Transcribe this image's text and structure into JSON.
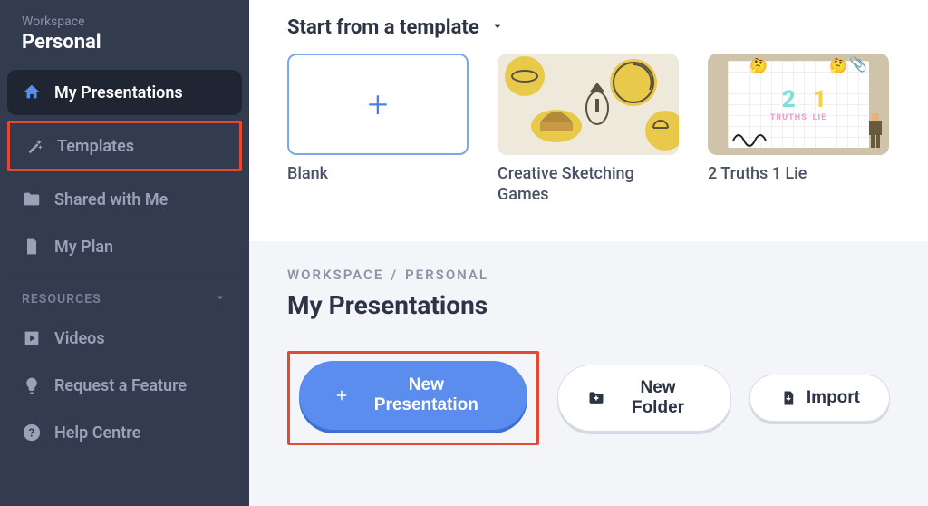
{
  "sidebar": {
    "workspace_label": "Workspace",
    "workspace_name": "Personal",
    "nav": {
      "my_presentations": "My Presentations",
      "templates": "Templates",
      "shared": "Shared with Me",
      "my_plan": "My Plan"
    },
    "resources_heading": "RESOURCES",
    "resources": {
      "videos": "Videos",
      "request_feature": "Request a Feature",
      "help_centre": "Help Centre"
    }
  },
  "templates": {
    "heading": "Start from a template",
    "items": [
      {
        "label": "Blank"
      },
      {
        "label": "Creative Sketching Games"
      },
      {
        "label": "2 Truths 1 Lie"
      }
    ],
    "truths_card": {
      "num1": "2",
      "txt1": "TRUTHS",
      "num2": "1",
      "txt2": "LIE"
    }
  },
  "folder": {
    "breadcrumb": {
      "a": "WORKSPACE",
      "sep": "/",
      "b": "PERSONAL"
    },
    "title": "My Presentations",
    "actions": {
      "new_presentation": "New Presentation",
      "new_folder": "New Folder",
      "import": "Import"
    }
  }
}
